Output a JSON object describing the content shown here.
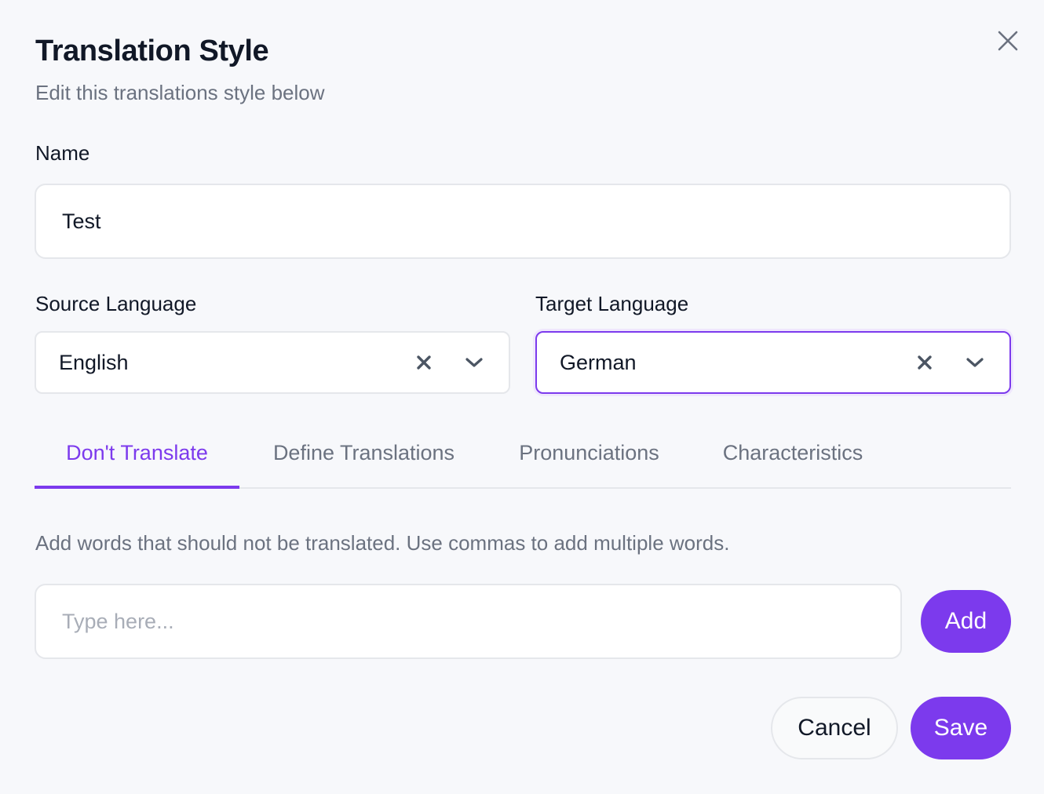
{
  "dialog": {
    "title": "Translation Style",
    "subtitle": "Edit this translations style below",
    "close_icon": "close-icon"
  },
  "name_field": {
    "label": "Name",
    "value": "Test"
  },
  "source_language": {
    "label": "Source Language",
    "value": "English",
    "clear_icon": "clear-x-icon",
    "dropdown_icon": "chevron-down-icon"
  },
  "target_language": {
    "label": "Target Language",
    "value": "German",
    "clear_icon": "clear-x-icon",
    "dropdown_icon": "chevron-down-icon"
  },
  "tabs": [
    {
      "label": "Don't Translate",
      "active": true
    },
    {
      "label": "Define Translations",
      "active": false
    },
    {
      "label": "Pronunciations",
      "active": false
    },
    {
      "label": "Characteristics",
      "active": false
    }
  ],
  "dont_translate": {
    "help_text": "Add words that should not be translated. Use commas to add multiple words.",
    "input_value": "",
    "input_placeholder": "Type here...",
    "add_label": "Add"
  },
  "footer": {
    "cancel_label": "Cancel",
    "save_label": "Save"
  },
  "colors": {
    "accent": "#7c3aed",
    "background": "#f7f8fb",
    "border": "#e5e7eb",
    "muted_text": "#6b7280"
  }
}
